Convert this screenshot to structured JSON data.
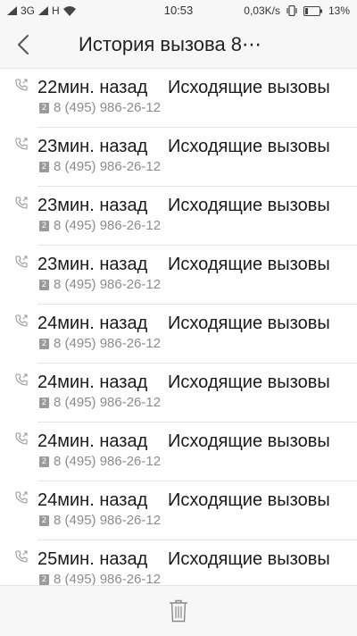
{
  "status": {
    "network1": "3G",
    "network2": "H",
    "time": "10:53",
    "speed": "0,03K/s",
    "battery": "13%"
  },
  "header": {
    "title": "История вызова 8⋯"
  },
  "calls": [
    {
      "time": "22мин. назад",
      "type": "Исходящие вызовы",
      "sim": "2",
      "number": "8 (495) 986-26-12"
    },
    {
      "time": "23мин. назад",
      "type": "Исходящие вызовы",
      "sim": "2",
      "number": "8 (495) 986-26-12"
    },
    {
      "time": "23мин. назад",
      "type": "Исходящие вызовы",
      "sim": "2",
      "number": "8 (495) 986-26-12"
    },
    {
      "time": "23мин. назад",
      "type": "Исходящие вызовы",
      "sim": "2",
      "number": "8 (495) 986-26-12"
    },
    {
      "time": "24мин. назад",
      "type": "Исходящие вызовы",
      "sim": "2",
      "number": "8 (495) 986-26-12"
    },
    {
      "time": "24мин. назад",
      "type": "Исходящие вызовы",
      "sim": "2",
      "number": "8 (495) 986-26-12"
    },
    {
      "time": "24мин. назад",
      "type": "Исходящие вызовы",
      "sim": "2",
      "number": "8 (495) 986-26-12"
    },
    {
      "time": "24мин. назад",
      "type": "Исходящие вызовы",
      "sim": "2",
      "number": "8 (495) 986-26-12"
    },
    {
      "time": "25мин. назад",
      "type": "Исходящие вызовы",
      "sim": "2",
      "number": "8 (495) 986-26-12"
    }
  ],
  "icons": {
    "back": "back-arrow-icon",
    "call": "outgoing-call-icon",
    "sim": "sim-2-icon",
    "delete": "trash-icon"
  }
}
